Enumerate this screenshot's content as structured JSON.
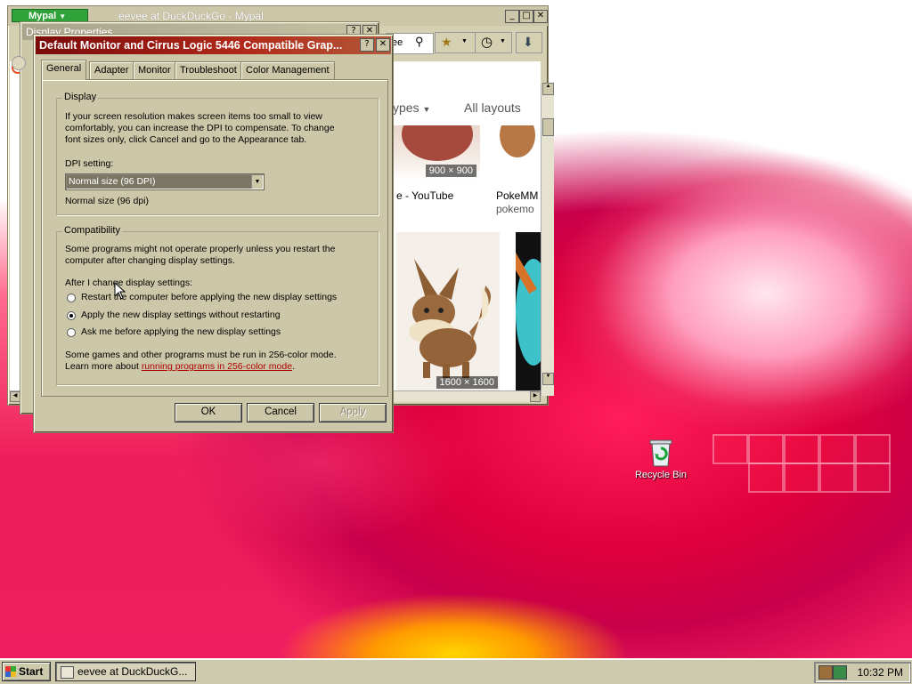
{
  "browser": {
    "menu_button": "Mypal",
    "title": "eevee at DuckDuckGo - Mypal",
    "search_fragment": "ee",
    "filter_types": "ypes",
    "filter_layouts": "All layouts",
    "results": [
      {
        "size": "900 × 900",
        "title": "e - YouTube",
        "source": ""
      },
      {
        "size": "",
        "title": "PokeMM",
        "source": "pokemo"
      },
      {
        "size": "1600 × 1600",
        "title": "",
        "source": ""
      }
    ]
  },
  "display_properties": {
    "title": "Display Properties"
  },
  "dialog": {
    "title": "Default Monitor and Cirrus Logic 5446 Compatible Grap...",
    "tabs": [
      "General",
      "Adapter",
      "Monitor",
      "Troubleshoot",
      "Color Management"
    ],
    "display_group": {
      "legend": "Display",
      "description_lines": [
        "If your screen resolution makes screen items too small to view",
        "comfortably, you can increase the DPI to compensate.  To change",
        "font sizes only, click Cancel and go to the Appearance tab."
      ],
      "dpi_label": "DPI setting:",
      "dpi_value": "Normal size (96 DPI)",
      "dpi_note": "Normal size (96 dpi)"
    },
    "compat_group": {
      "legend": "Compatibility",
      "description_lines": [
        "Some programs might not operate properly unless you restart the",
        "computer after changing display settings."
      ],
      "after_label": "After I change display settings:",
      "options": [
        {
          "label": "Restart the computer before applying the new display settings",
          "selected": false
        },
        {
          "label": "Apply the new display settings without restarting",
          "selected": true
        },
        {
          "label": "Ask me before applying the new display settings",
          "selected": false
        }
      ],
      "footer_line1": "Some games and other programs must be run in 256-color mode.",
      "footer_line2_prefix": "Learn more about ",
      "footer_link": "running programs in 256-color mode",
      "footer_line2_suffix": "."
    },
    "buttons": {
      "ok": "OK",
      "cancel": "Cancel",
      "apply": "Apply"
    }
  },
  "desktop": {
    "recycle_bin": "Recycle Bin"
  },
  "taskbar": {
    "start": "Start",
    "task": "eevee at DuckDuckG...",
    "clock": "10:32 PM"
  },
  "colors": {
    "dialog_title_gradient": [
      "#7a0a0a",
      "#b35a3a"
    ],
    "window_face": "#ccc7a8",
    "link": "#b00000",
    "mypal_green": "#2fa33a"
  }
}
